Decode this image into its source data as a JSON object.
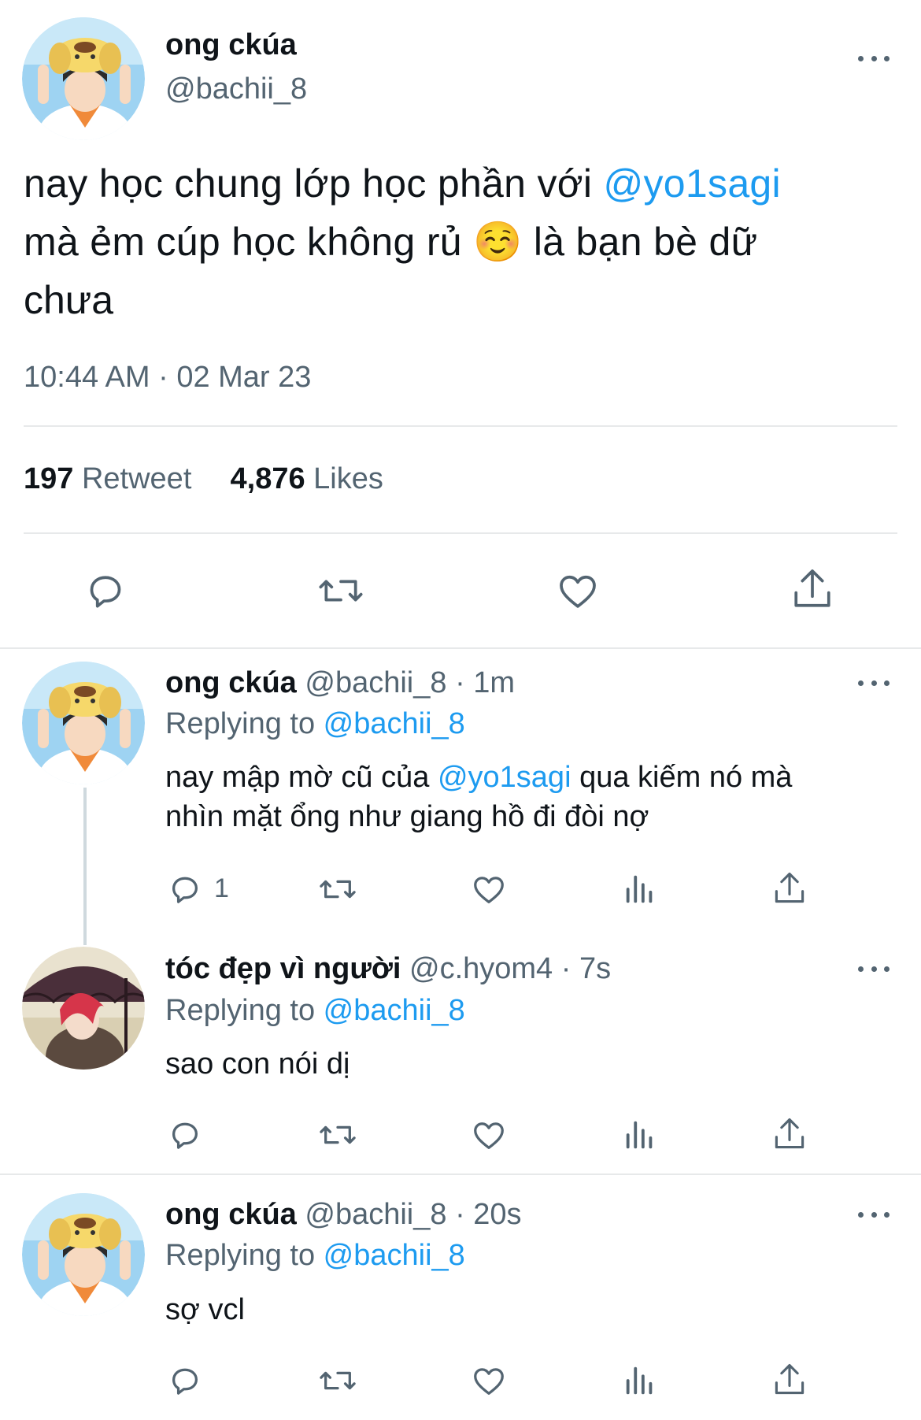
{
  "main_tweet": {
    "author_name": "ong ckúa",
    "author_handle": "@bachii_8",
    "text_line1_a": "nay học chung lớp học phần với ",
    "text_line1_mention": "@yo1sagi",
    "text_line2_a": "mà ẻm cúp học không rủ ",
    "text_line2_emoji": "☺️",
    "text_line2_b": " là bạn bè dữ",
    "text_line3": "chưa",
    "timestamp": "10:44 AM · 02 Mar 23",
    "retweet_count": "197",
    "retweet_label": "Retweet",
    "likes_count": "4,876",
    "likes_label": "Likes"
  },
  "replies": [
    {
      "author_name": "ong ckúa",
      "author_handle": "@bachii_8",
      "time": "· 1m",
      "replying_label": "Replying to ",
      "replying_handle": "@bachii_8",
      "text_line1_a": "nay mập mờ cũ của ",
      "text_line1_mention": "@yo1sagi",
      "text_line1_b": " qua kiếm nó mà",
      "text_line2": "nhìn mặt ổng như giang hồ đi đòi nợ",
      "reply_count": "1"
    },
    {
      "author_name": "tóc đẹp vì người",
      "author_handle": "@c.hyom4",
      "time": "· 7s",
      "replying_label": "Replying to ",
      "replying_handle": "@bachii_8",
      "text_line1_a": "sao con nói dị"
    },
    {
      "author_name": "ong ckúa",
      "author_handle": "@bachii_8",
      "time": "· 20s",
      "replying_label": "Replying to ",
      "replying_handle": "@bachii_8",
      "text_line1_a": "sợ vcl"
    }
  ],
  "colors": {
    "text": "#0f1419",
    "secondary": "#536471",
    "accent": "#1d9bf0",
    "divider": "#e7e9ea"
  },
  "icons": [
    "reply-icon",
    "retweet-icon",
    "like-icon",
    "share-icon",
    "analytics-icon",
    "more-icon"
  ]
}
